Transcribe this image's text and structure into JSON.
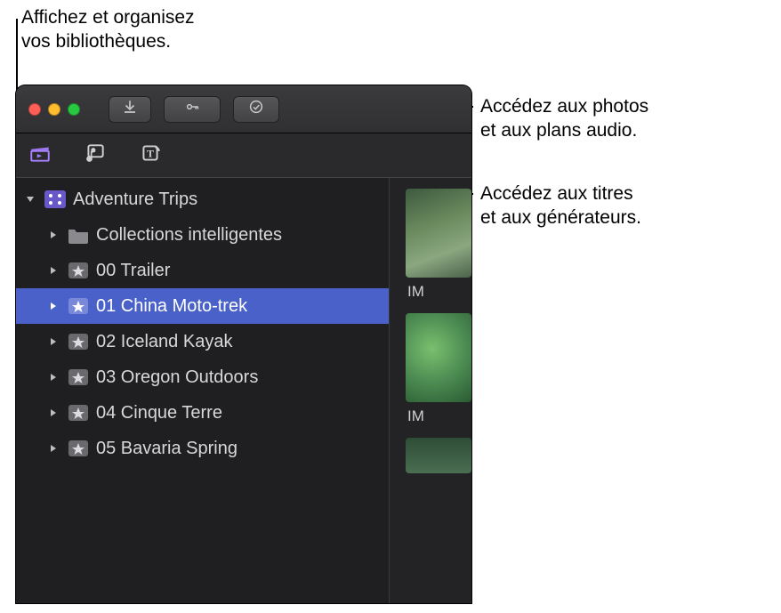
{
  "callouts": {
    "libraries": "Affichez et organisez\nvos bibliothèques.",
    "photosAudio": "Accédez aux photos\net aux plans audio.",
    "titlesGenerators": "Accédez aux titres\net aux générateurs."
  },
  "library": {
    "rootName": "Adventure Trips",
    "items": [
      {
        "name": "Collections intelligentes",
        "kind": "smart-folder"
      },
      {
        "name": "00 Trailer",
        "kind": "event"
      },
      {
        "name": "01 China Moto-trek",
        "kind": "event",
        "selected": true
      },
      {
        "name": "02 Iceland Kayak",
        "kind": "event"
      },
      {
        "name": "03 Oregon Outdoors",
        "kind": "event"
      },
      {
        "name": "04 Cinque Terre",
        "kind": "event"
      },
      {
        "name": "05 Bavaria Spring",
        "kind": "event"
      }
    ]
  },
  "thumbnails": {
    "labelPrefix": "IM"
  }
}
